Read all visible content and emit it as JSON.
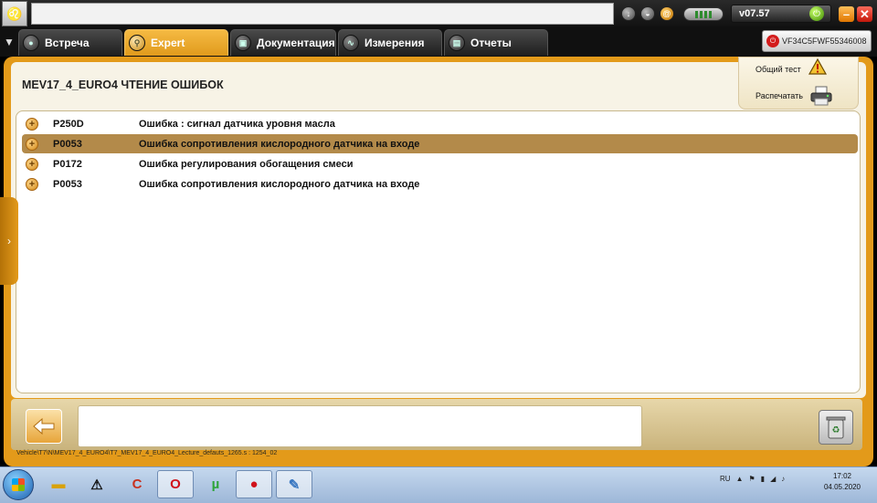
{
  "topbar": {
    "version": "v07.57",
    "min_label": "–",
    "close_label": "✕"
  },
  "tabs": [
    {
      "label": "Встреча"
    },
    {
      "label": "Expert"
    },
    {
      "label": "Документация"
    },
    {
      "label": "Измерения"
    },
    {
      "label": "Отчеты"
    }
  ],
  "vin": "VF34C5FWF55346008",
  "page": {
    "title": "MEV17_4_EURO4  ЧТЕНИЕ ОШИБОК"
  },
  "tools": {
    "general_test": "Общий тест",
    "print": "Распечатать"
  },
  "faults": [
    {
      "code": "P250D",
      "description": "Ошибка : сигнал датчика уровня масла",
      "selected": false
    },
    {
      "code": "P0053",
      "description": "Ошибка сопротивления кислородного датчика на входе",
      "selected": true
    },
    {
      "code": "P0172",
      "description": "Ошибка регулирования обогащения смеси",
      "selected": false
    },
    {
      "code": "P0053",
      "description": "Ошибка сопротивления кислородного датчика на входе",
      "selected": false
    }
  ],
  "status_path": "Vehicle\\T7\\N\\MEV17_4_EURO4\\T7_MEV17_4_EURO4_Lecture_defauts_1265.s : 1254_02",
  "taskbar": {
    "language": "RU",
    "time": "17:02",
    "date": "04.05.2020"
  },
  "colors": {
    "accent": "#e39a1a",
    "selected_row": "#b38a4a"
  }
}
